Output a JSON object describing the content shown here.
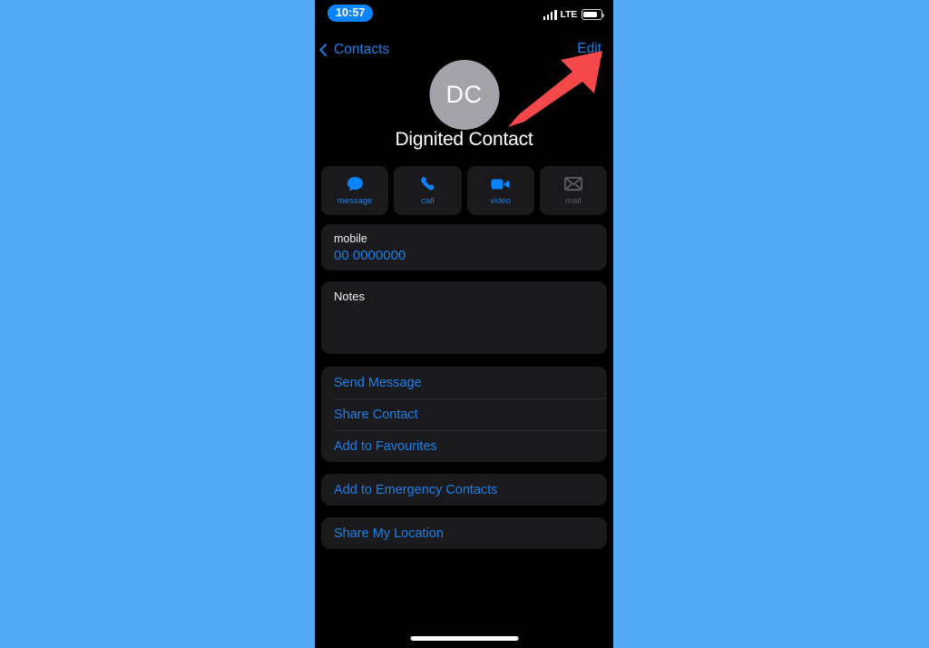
{
  "background_color": "#55AAF8",
  "accent_color": "#1C7FEA",
  "annotation": {
    "type": "arrow",
    "name": "red-arrow-pointing-to-edit",
    "color": "#F4484B",
    "points_to": "Edit"
  },
  "status_bar": {
    "time": "10:57",
    "time_pill_color": "#0A84FF",
    "network": "LTE",
    "signal_bars": 4,
    "battery_percent": 68
  },
  "nav_bar": {
    "back_label": "Contacts",
    "edit_label": "Edit"
  },
  "header": {
    "avatar_initials": "DC",
    "avatar_color": "#A3A3A9",
    "contact_name": "Dignited Contact"
  },
  "actions": [
    {
      "label": "message",
      "icon": "message-bubble-icon",
      "enabled": true
    },
    {
      "label": "call",
      "icon": "phone-icon",
      "enabled": true
    },
    {
      "label": "video",
      "icon": "video-camera-icon",
      "enabled": true
    },
    {
      "label": "mail",
      "icon": "envelope-icon",
      "enabled": false
    }
  ],
  "fields": {
    "mobile_label": "mobile",
    "mobile_value": "00 0000000",
    "notes_label": "Notes",
    "notes_value": ""
  },
  "list_group": [
    {
      "label": "Send Message"
    },
    {
      "label": "Share Contact"
    },
    {
      "label": "Add to Favourites"
    }
  ],
  "emergency": {
    "label": "Add to Emergency Contacts"
  },
  "location": {
    "label": "Share My Location"
  }
}
